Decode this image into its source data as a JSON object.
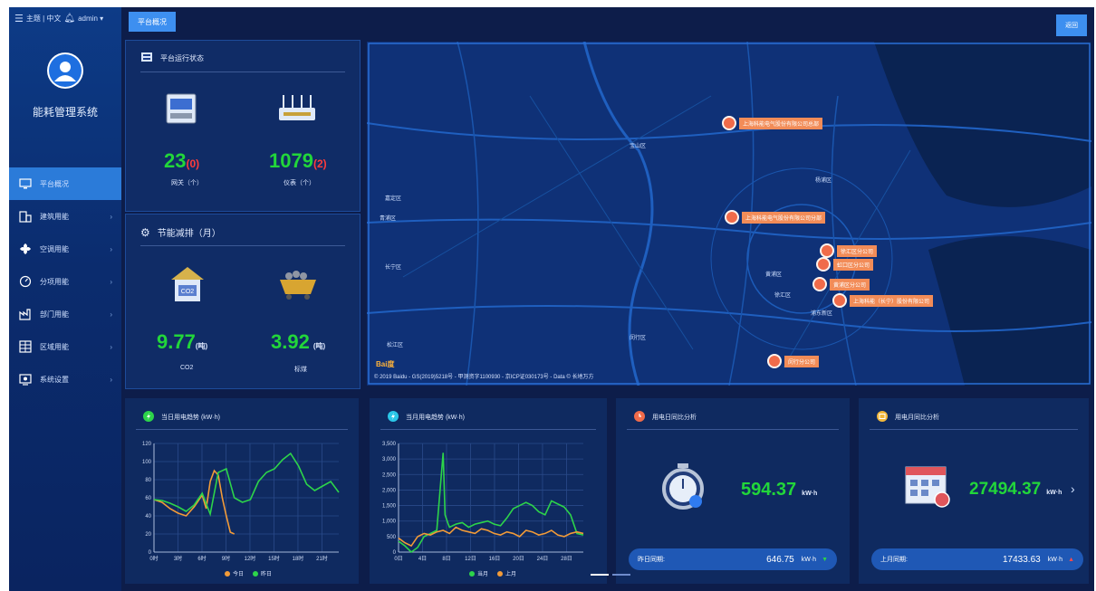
{
  "header": {
    "user_info": "主题 | 中文",
    "user_name": "admin ▾",
    "active_tab": "平台概况",
    "top_right_button": "返回"
  },
  "sidebar": {
    "system_title": "能耗管理系统",
    "items": [
      {
        "label": "平台概况",
        "icon": "monitor-icon",
        "active": true
      },
      {
        "label": "建筑用能",
        "icon": "building-icon",
        "active": false
      },
      {
        "label": "空调用能",
        "icon": "fan-icon",
        "active": false
      },
      {
        "label": "分项用能",
        "icon": "gauge-icon",
        "active": false
      },
      {
        "label": "部门用能",
        "icon": "factory-icon",
        "active": false
      },
      {
        "label": "区域用能",
        "icon": "grid-building-icon",
        "active": false
      },
      {
        "label": "系统设置",
        "icon": "settings-icon",
        "active": false
      }
    ]
  },
  "status_panel": {
    "title": "平台运行状态",
    "left_value": "23",
    "left_badge": "(0)",
    "left_label": "网关（个）",
    "right_value": "1079",
    "right_badge": "(2)",
    "right_label": "仪表（个）"
  },
  "carbon_panel": {
    "title": "节能减排（月）",
    "left_value": "9.77",
    "left_unit": "(吨)",
    "left_label": "CO2",
    "right_value": "3.92",
    "right_unit": "(吨)",
    "right_label": "标煤",
    "icon_label": "CO2"
  },
  "map": {
    "district_labels": [
      "嘉定区",
      "宝山区",
      "杨浦区",
      "青浦区",
      "闵行区",
      "松江区",
      "浦东新区",
      "黄浦区",
      "长宁区",
      "徐汇区"
    ],
    "pins": [
      {
        "text": "上海科能电气股份有限公司总部"
      },
      {
        "text": "上海科能电气股份有限公司分部"
      },
      {
        "text": "徐汇区分公司"
      },
      {
        "text": "虹口区分公司"
      },
      {
        "text": "黄浦区分公司"
      },
      {
        "text": "上海科能（长宁）股份有限公司"
      },
      {
        "text": "闵行分公司"
      }
    ],
    "footer": "© 2019 Baidu - GS(2019)5218号 - 甲测资字1100930 - 京ICP证030173号 - Data © 长地万方",
    "logo": "Bai度"
  },
  "charts": {
    "today": {
      "title": "当日用电趋势 (kW·h)",
      "legend": [
        "今日",
        "昨日"
      ]
    },
    "month": {
      "title": "当月用电趋势 (kW·h)",
      "legend": [
        "当月",
        "上月"
      ]
    }
  },
  "chart_data": [
    {
      "type": "line",
      "title": "当日用电趋势 (kW·h)",
      "categories": [
        "0时",
        "3时",
        "6时",
        "9时",
        "12时",
        "15时",
        "18时",
        "21时"
      ],
      "ylim": [
        0,
        120
      ],
      "yticks": [
        0,
        20,
        40,
        60,
        80,
        100,
        120
      ],
      "series": [
        {
          "name": "今日",
          "color": "#f29b38",
          "x": [
            0,
            1,
            2,
            3,
            4,
            5,
            6,
            6.5,
            7,
            7.5,
            8,
            8.5,
            9,
            9.5,
            10
          ],
          "values": [
            58,
            55,
            48,
            43,
            40,
            50,
            63,
            48,
            78,
            90,
            85,
            60,
            40,
            22,
            20
          ]
        },
        {
          "name": "昨日",
          "color": "#2dd44a",
          "x": [
            0,
            1,
            2,
            3,
            4,
            5,
            6,
            7,
            8,
            9,
            10,
            11,
            12,
            13,
            14,
            15,
            16,
            17,
            18,
            19,
            20,
            21,
            22,
            23
          ],
          "values": [
            58,
            57,
            54,
            50,
            45,
            52,
            65,
            42,
            88,
            92,
            60,
            55,
            58,
            78,
            88,
            92,
            102,
            109,
            95,
            75,
            68,
            73,
            78,
            66
          ]
        }
      ]
    },
    {
      "type": "line",
      "title": "当月用电趋势 (kW·h)",
      "categories": [
        "0日",
        "4日",
        "8日",
        "12日",
        "16日",
        "20日",
        "24日",
        "28日"
      ],
      "ylim": [
        0,
        3500
      ],
      "yticks": [
        "0",
        "500",
        "1,000",
        "1,500",
        "2,000",
        "2,500",
        "3,000",
        "3,500"
      ],
      "series": [
        {
          "name": "当月",
          "color": "#2dd44a",
          "x": [
            0,
            1,
            2,
            3,
            4,
            5,
            6,
            7,
            7.3,
            7.8,
            8,
            9,
            10,
            11,
            12,
            13,
            14,
            15,
            16,
            17,
            18,
            19,
            20,
            21,
            22,
            23,
            24,
            25,
            26,
            27,
            28,
            29
          ],
          "values": [
            350,
            200,
            0,
            150,
            500,
            600,
            700,
            3200,
            1200,
            900,
            800,
            900,
            950,
            800,
            900,
            950,
            1000,
            900,
            850,
            1100,
            1400,
            1500,
            1600,
            1500,
            1300,
            1200,
            1650,
            1550,
            1450,
            1200,
            600,
            550
          ]
        },
        {
          "name": "上月",
          "color": "#f29b38",
          "x": [
            0,
            1,
            2,
            3,
            4,
            5,
            6,
            7,
            8,
            9,
            10,
            11,
            12,
            13,
            14,
            15,
            16,
            17,
            18,
            19,
            20,
            21,
            22,
            23,
            24,
            25,
            26,
            27,
            28,
            29
          ],
          "values": [
            450,
            300,
            200,
            500,
            600,
            550,
            650,
            700,
            600,
            800,
            700,
            650,
            600,
            750,
            700,
            600,
            550,
            650,
            600,
            500,
            700,
            650,
            550,
            600,
            700,
            550,
            500,
            600,
            650,
            600
          ]
        }
      ]
    }
  ],
  "day_analysis": {
    "title": "用电日同比分析",
    "value": "594.37",
    "unit": "kW·h",
    "compare_label": "昨日同期:",
    "compare_value": "646.75",
    "compare_unit": "kW·h",
    "arrow": "▼"
  },
  "month_analysis": {
    "title": "用电月同比分析",
    "value": "27494.37",
    "unit": "kW·h",
    "compare_label": "上月同期:",
    "compare_value": "17433.63",
    "compare_unit": "kW·h",
    "arrow": "▲",
    "next": "›"
  }
}
